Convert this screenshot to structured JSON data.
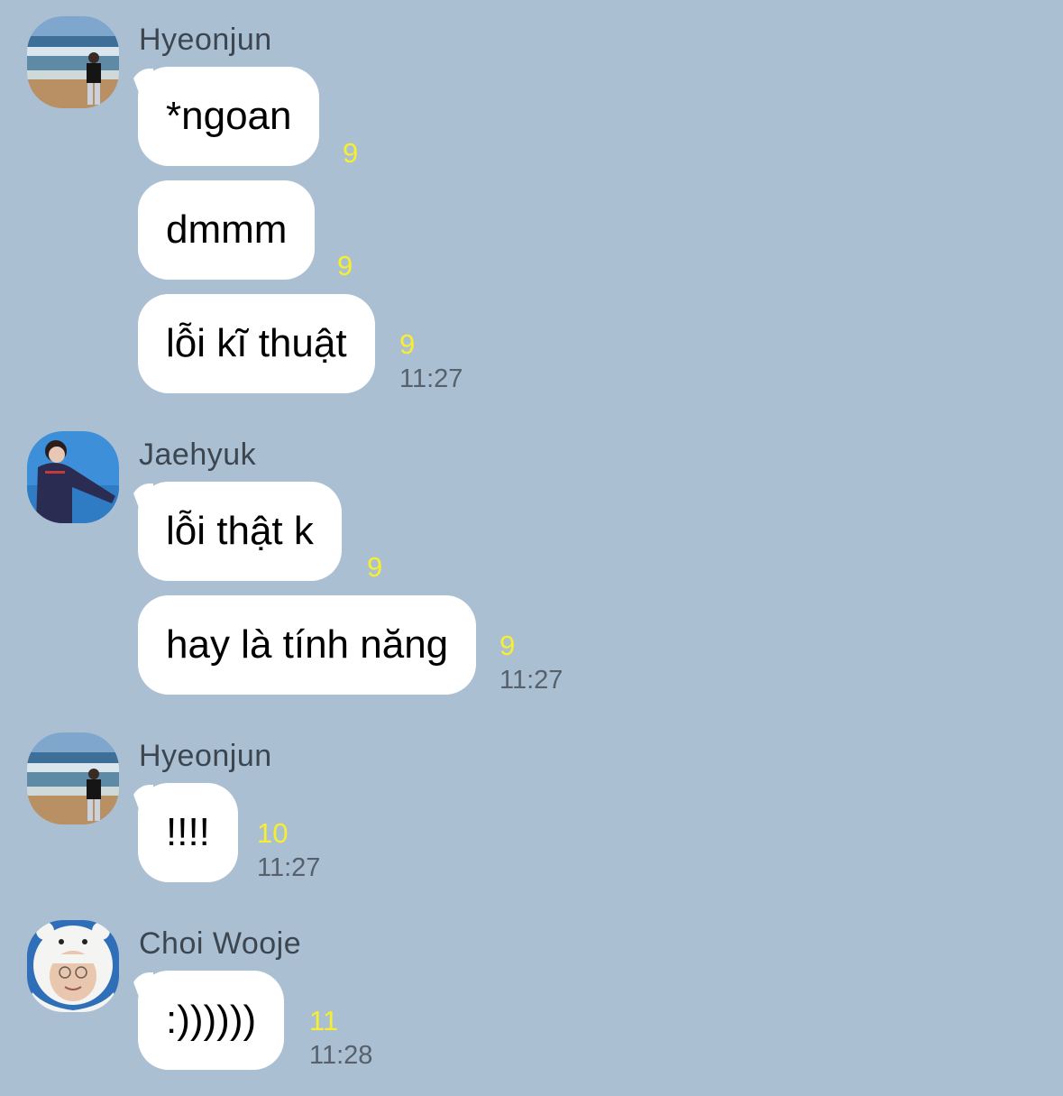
{
  "colors": {
    "background": "#abbfd3",
    "bubble": "#ffffff",
    "unread_count": "#f7ee2f",
    "timestamp": "#56616c",
    "sender_name": "#3c4650"
  },
  "groups": [
    {
      "sender": "Hyeonjun",
      "avatar_icon": "beach-photo-avatar",
      "messages": [
        {
          "text": "*ngoan",
          "unread": "9",
          "time": ""
        },
        {
          "text": "dmmm",
          "unread": "9",
          "time": ""
        },
        {
          "text": "lỗi kĩ thuật",
          "unread": "9",
          "time": "11:27"
        }
      ]
    },
    {
      "sender": "Jaehyuk",
      "avatar_icon": "person-jacket-avatar",
      "messages": [
        {
          "text": "lỗi thật k",
          "unread": "9",
          "time": ""
        },
        {
          "text": "hay là tính năng",
          "unread": "9",
          "time": "11:27"
        }
      ]
    },
    {
      "sender": "Hyeonjun",
      "avatar_icon": "beach-photo-avatar",
      "messages": [
        {
          "text": "!!!!",
          "unread": "10",
          "time": "11:27"
        }
      ]
    },
    {
      "sender": "Choi Wooje",
      "avatar_icon": "polar-bear-hood-avatar",
      "messages": [
        {
          "text": ":))))))",
          "unread": "11",
          "time": "11:28"
        }
      ]
    }
  ]
}
